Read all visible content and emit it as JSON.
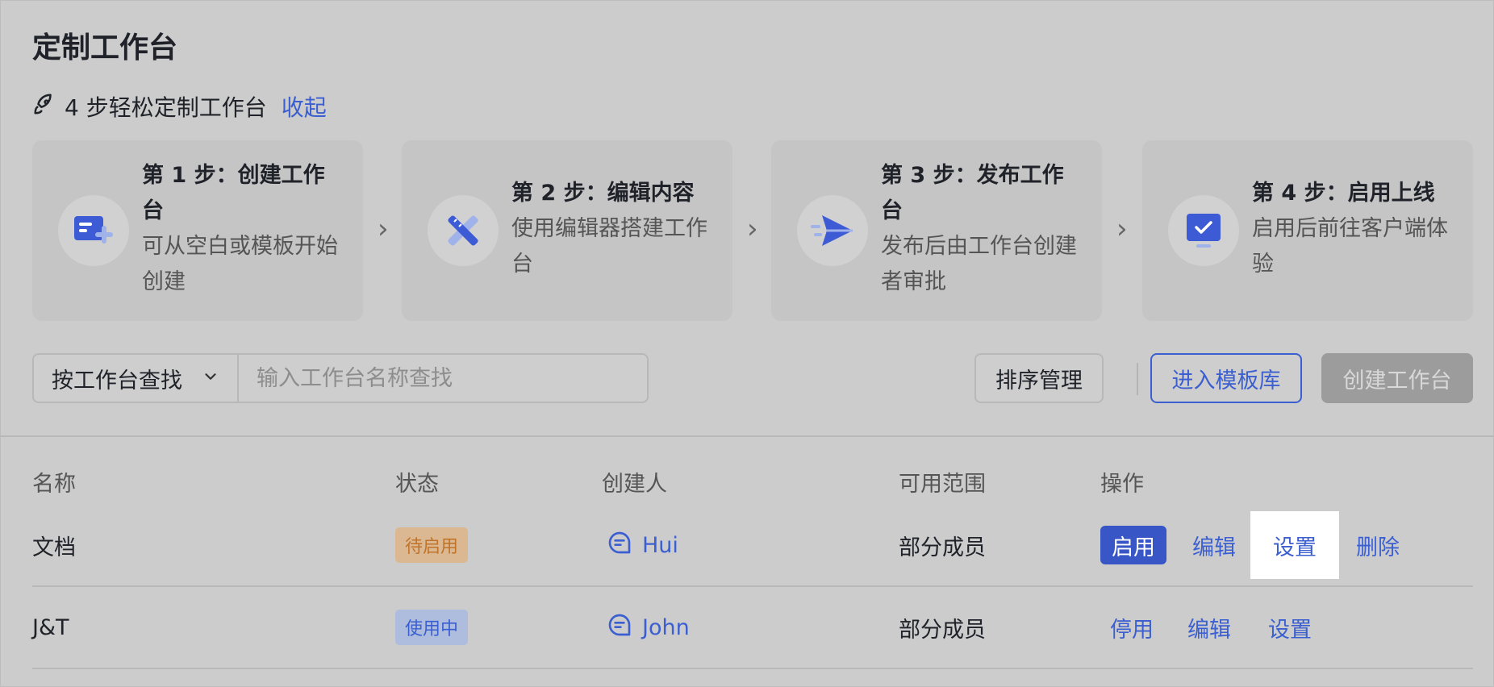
{
  "page": {
    "title": "定制工作台",
    "guide_text": "4 步轻松定制工作台",
    "collapse_label": "收起"
  },
  "steps": [
    {
      "title": "第 1 步：创建工作台",
      "desc": "可从空白或模板开始创建",
      "icon": "card-plus-icon"
    },
    {
      "title": "第 2 步：编辑内容",
      "desc": "使用编辑器搭建工作台",
      "icon": "pencil-ruler-icon"
    },
    {
      "title": "第 3 步：发布工作台",
      "desc": "发布后由工作台创建者审批",
      "icon": "send-icon"
    },
    {
      "title": "第 4 步：启用上线",
      "desc": "启用后前往客户端体验",
      "icon": "monitor-check-icon"
    }
  ],
  "search": {
    "filter_label": "按工作台查找",
    "placeholder": "输入工作台名称查找"
  },
  "toolbar": {
    "sort_label": "排序管理",
    "template_label": "进入模板库",
    "create_label": "创建工作台"
  },
  "table": {
    "headers": {
      "name": "名称",
      "status": "状态",
      "creator": "创建人",
      "scope": "可用范围",
      "actions": "操作"
    },
    "rows": [
      {
        "name": "文档",
        "status": "待启用",
        "creator": "Hui",
        "scope": "部分成员",
        "actions": [
          "启用",
          "编辑",
          "设置",
          "删除"
        ]
      },
      {
        "name": "J&T",
        "status": "使用中",
        "creator": "John",
        "scope": "部分成员",
        "actions": [
          "停用",
          "编辑",
          "设置"
        ]
      }
    ]
  },
  "colors": {
    "accent": "#3b5fd0",
    "background": "#cccccc",
    "pending_badge": "#dcb892",
    "active_badge": "#aebcdd"
  }
}
